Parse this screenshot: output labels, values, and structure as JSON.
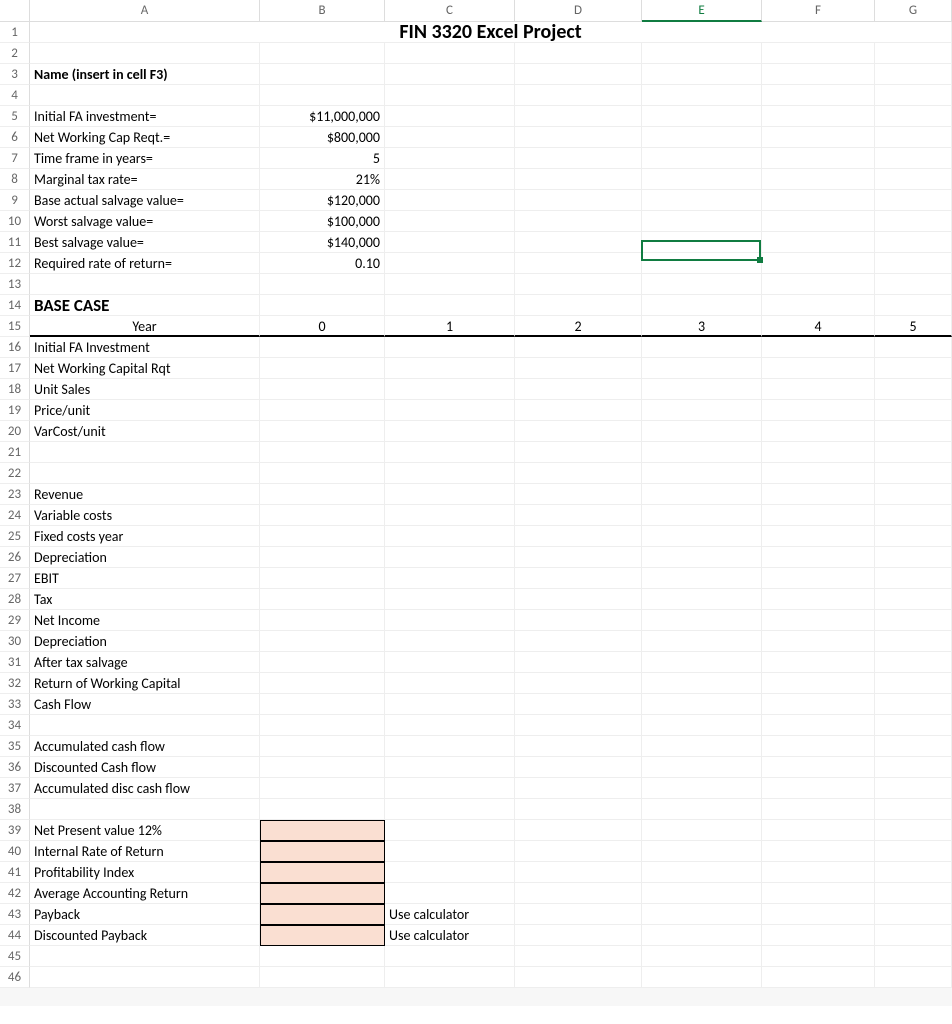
{
  "columns": [
    "A",
    "B",
    "C",
    "D",
    "E",
    "F",
    "G"
  ],
  "title": "FIN 3320 Excel Project",
  "name_label": "Name (insert in cell F3)",
  "inputs": [
    {
      "label": "Initial FA investment=",
      "value": "$11,000,000"
    },
    {
      "label": "Net Working Cap Reqt.=",
      "value": "$800,000"
    },
    {
      "label": "Time frame in years=",
      "value": "5"
    },
    {
      "label": "Marginal tax rate=",
      "value": "21%"
    },
    {
      "label": "Base actual salvage value=",
      "value": "$120,000"
    },
    {
      "label": "Worst salvage value=",
      "value": "$100,000"
    },
    {
      "label": "Best salvage value=",
      "value": "$140,000"
    },
    {
      "label": "Required rate of return=",
      "value": "0.10"
    }
  ],
  "base_case_label": "BASE CASE",
  "year_label": "Year",
  "years": [
    "0",
    "1",
    "2",
    "3",
    "4",
    "5"
  ],
  "rows_a": [
    "Initial FA Investment",
    "Net Working Capital Rqt",
    "Unit Sales",
    "Price/unit",
    "VarCost/unit"
  ],
  "rows_b": [
    "Revenue",
    "Variable costs",
    "Fixed costs year",
    "Depreciation"
  ],
  "rows_c": [
    "EBIT",
    "Tax"
  ],
  "rows_d": [
    "Net Income",
    "Depreciation",
    "After tax salvage",
    "Return of Working Capital",
    "Cash Flow"
  ],
  "rows_e": [
    "Accumulated cash flow",
    "Discounted Cash flow",
    "Accumulated disc cash flow"
  ],
  "metrics": [
    {
      "label": "Net Present value 12%",
      "note": ""
    },
    {
      "label": "Internal Rate of Return",
      "note": ""
    },
    {
      "label": "Profitability Index",
      "note": ""
    },
    {
      "label": "Average Accounting Return",
      "note": ""
    },
    {
      "label": "Payback",
      "note": "Use calculator"
    },
    {
      "label": "Discounted Payback",
      "note": "Use calculator"
    }
  ],
  "active_col": "E",
  "selected_cell": "E11"
}
